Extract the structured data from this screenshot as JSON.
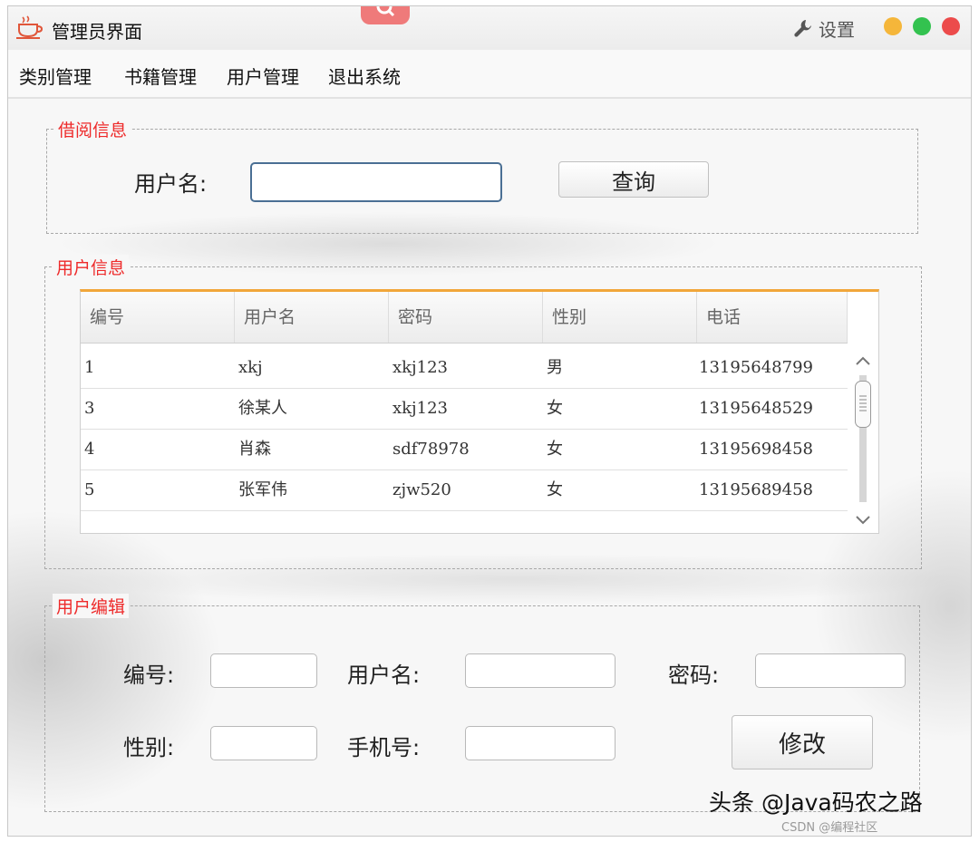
{
  "window": {
    "title": "管理员界面",
    "settings_label": "设置",
    "controls": {
      "minimize_color": "#f5b63a",
      "maximize_color": "#33c24f",
      "close_color": "#ec4b4b"
    }
  },
  "menu": {
    "items": [
      {
        "label": "类别管理"
      },
      {
        "label": "书籍管理"
      },
      {
        "label": "用户管理"
      },
      {
        "label": "退出系统"
      }
    ]
  },
  "borrow_panel": {
    "title": "借阅信息",
    "username_label": "用户名:",
    "username_value": "",
    "query_button": "查询"
  },
  "user_panel": {
    "title": "用户信息",
    "columns": [
      "编号",
      "用户名",
      "密码",
      "性别",
      "电话"
    ],
    "rows": [
      {
        "id": "1",
        "username": "xkj",
        "password": "xkj123",
        "gender": "男",
        "phone": "13195648799"
      },
      {
        "id": "3",
        "username": "徐某人",
        "password": "xkj123",
        "gender": "女",
        "phone": "13195648529"
      },
      {
        "id": "4",
        "username": "肖森",
        "password": "sdf78978",
        "gender": "女",
        "phone": "13195698458"
      },
      {
        "id": "5",
        "username": "张军伟",
        "password": "zjw520",
        "gender": "女",
        "phone": "13195689458"
      }
    ]
  },
  "edit_panel": {
    "title": "用户编辑",
    "id_label": "编号:",
    "username_label": "用户名:",
    "password_label": "密码:",
    "gender_label": "性别:",
    "phone_label": "手机号:",
    "id_value": "",
    "username_value": "",
    "password_value": "",
    "gender_value": "",
    "phone_value": "",
    "modify_button": "修改"
  },
  "accent_colors": {
    "section_title": "#ee2a2a",
    "table_top_border": "#f1a63a",
    "focus_border": "#4a6f94"
  },
  "watermark": {
    "text": "头条 @Java码农之路",
    "small": "CSDN @编程社区"
  }
}
